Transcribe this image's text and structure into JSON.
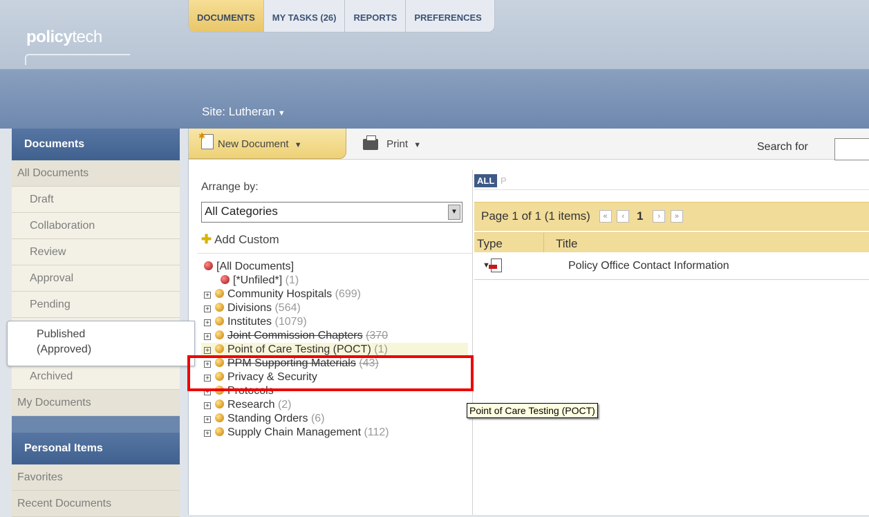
{
  "app": {
    "logo_bold": "policy",
    "logo_light": "tech"
  },
  "tabs": [
    {
      "label": "DOCUMENTS",
      "active": true
    },
    {
      "label": "MY TASKS (26)"
    },
    {
      "label": "REPORTS"
    },
    {
      "label": "PREFERENCES"
    }
  ],
  "site": {
    "label": "Site: Lutheran"
  },
  "sidebar": {
    "documents_header": "Documents",
    "all_documents": "All Documents",
    "items": [
      "Draft",
      "Collaboration",
      "Review",
      "Approval",
      "Pending"
    ],
    "published_line1": "Published",
    "published_line2": "(Approved)",
    "archived": "Archived",
    "my_documents": "My Documents",
    "personal_header": "Personal Items",
    "favorites": "Favorites",
    "recent_documents": "Recent Documents"
  },
  "toolbar": {
    "new_document": "New Document",
    "print": "Print",
    "search_label": "Search for",
    "search_value": ""
  },
  "arrange": {
    "label": "Arrange by:",
    "selected": "All Categories",
    "add_custom": "Add Custom"
  },
  "tree": [
    {
      "name": "[All Documents]",
      "count": "",
      "color": "red"
    },
    {
      "name": "[*Unfiled*]",
      "count": "(1)",
      "color": "red"
    },
    {
      "name": "Community Hospitals",
      "count": "(699)",
      "color": "orange"
    },
    {
      "name": "Divisions",
      "count": "(564)",
      "color": "orange"
    },
    {
      "name": "Institutes",
      "count": "(1079)",
      "color": "orange"
    },
    {
      "name": "Joint Commission Chapters",
      "count": "(370",
      "color": "orange"
    },
    {
      "name": "Point of Care Testing (POCT)",
      "count": "(1)",
      "color": "orange"
    },
    {
      "name": "PPM Supporting Materials",
      "count": "(43)",
      "color": "orange"
    },
    {
      "name": "Privacy & Security",
      "count": "",
      "color": "orange"
    },
    {
      "name": "Protocols",
      "count": "",
      "color": "orange"
    },
    {
      "name": "Research",
      "count": "(2)",
      "color": "orange"
    },
    {
      "name": "Standing Orders",
      "count": "(6)",
      "color": "orange"
    },
    {
      "name": "Supply Chain Management",
      "count": "(112)",
      "color": "orange"
    }
  ],
  "filters": {
    "all": "ALL",
    "p": "P"
  },
  "pager": {
    "text": "Page 1 of 1 (1 items)",
    "current": "1"
  },
  "table": {
    "col_type": "Type",
    "col_title": "Title",
    "rows": [
      {
        "title": "Policy Office Contact Information"
      }
    ]
  },
  "tooltip": {
    "text": "Point of Care Testing (POCT)"
  },
  "colors": {
    "accent_gold": "#f1dc9a",
    "sidebar_blue": "#40618f",
    "highlight_red": "#e00000"
  }
}
